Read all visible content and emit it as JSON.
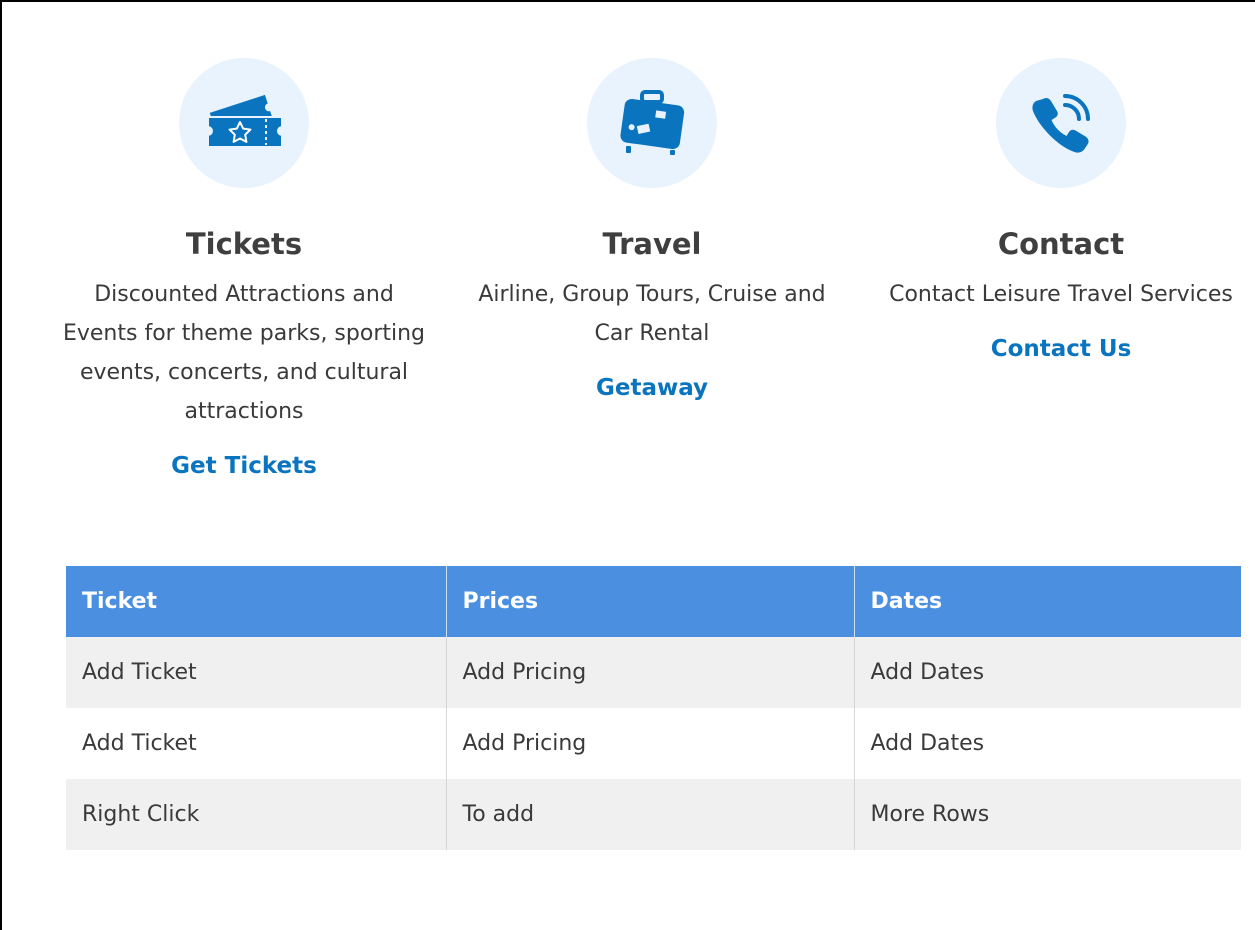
{
  "cards": [
    {
      "icon": "ticket-icon",
      "title": "Tickets",
      "description": "Discounted Attractions and Events for theme parks, sporting events, concerts, and cultural attractions",
      "link": "Get Tickets"
    },
    {
      "icon": "suitcase-icon",
      "title": "Travel",
      "description": "Airline, Group Tours, Cruise and Car Rental",
      "link": "Getaway"
    },
    {
      "icon": "phone-icon",
      "title": "Contact",
      "description": "Contact Leisure Travel Services",
      "link": "Contact Us"
    }
  ],
  "colors": {
    "accent": "#0a74bf",
    "icon_bg": "#e8f3fd",
    "table_header": "#4a8fe0",
    "row_alt": "#f0f0f0"
  },
  "table": {
    "headers": [
      "Ticket",
      "Prices",
      "Dates"
    ],
    "rows": [
      [
        "Add Ticket",
        "Add Pricing",
        "Add Dates"
      ],
      [
        "Add Ticket",
        "Add Pricing",
        "Add Dates"
      ],
      [
        "Right Click",
        "To add",
        "More Rows"
      ]
    ]
  }
}
